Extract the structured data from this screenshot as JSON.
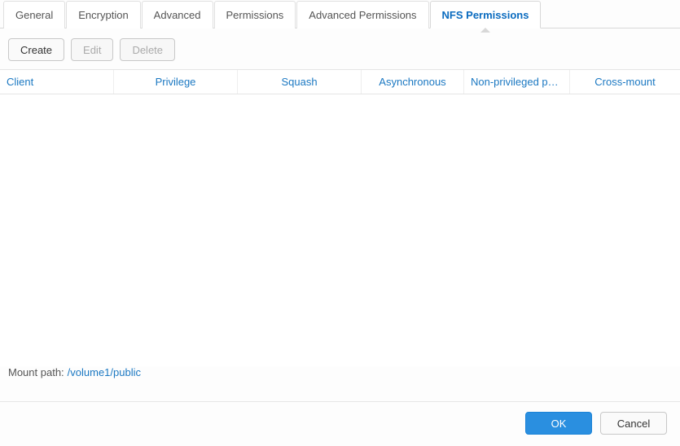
{
  "tabs": {
    "items": [
      {
        "label": "General"
      },
      {
        "label": "Encryption"
      },
      {
        "label": "Advanced"
      },
      {
        "label": "Permissions"
      },
      {
        "label": "Advanced Permissions"
      },
      {
        "label": "NFS Permissions"
      }
    ],
    "active_index": 5
  },
  "toolbar": {
    "create_label": "Create",
    "edit_label": "Edit",
    "delete_label": "Delete"
  },
  "table": {
    "columns": {
      "client": "Client",
      "privilege": "Privilege",
      "squash": "Squash",
      "asynchronous": "Asynchronous",
      "non_privileged": "Non-privileged p…",
      "cross_mount": "Cross-mount"
    },
    "rows": []
  },
  "mount_path": {
    "label": "Mount path:",
    "value": "/volume1/public"
  },
  "footer": {
    "ok_label": "OK",
    "cancel_label": "Cancel"
  }
}
